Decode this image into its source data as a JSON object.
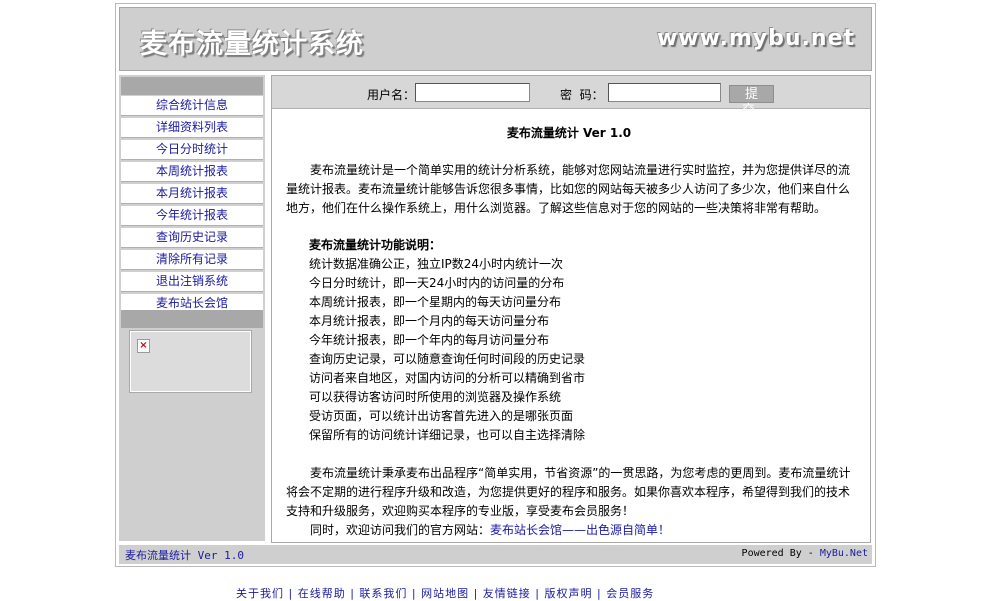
{
  "header": {
    "title": "麦布流量统计系统",
    "url": "www.mybu.net"
  },
  "sidebar": {
    "items": [
      "综合统计信息",
      "详细资料列表",
      "今日分时统计",
      "本周统计报表",
      "本月统计报表",
      "今年统计报表",
      "查询历史记录",
      "清除所有记录",
      "退出注销系统",
      "麦布站长会馆"
    ],
    "broken_image_glyph": "×"
  },
  "login": {
    "username_label": "用户名：",
    "password_label": "密  码：",
    "username_value": "",
    "password_value": "",
    "submit_label": "提交"
  },
  "content": {
    "title": "麦布流量统计 Ver 1.0",
    "intro": "麦布流量统计是一个简单实用的统计分析系统，能够对您网站流量进行实时监控，并为您提供详尽的流量统计报表。麦布流量统计能够告诉您很多事情，比如您的网站每天被多少人访问了多少次，他们来自什么地方，他们在什么操作系统上，用什么浏览器。了解这些信息对于您的网站的一些决策将非常有帮助。",
    "features_heading": "麦布流量统计功能说明：",
    "features": [
      "统计数据准确公正，独立IP数24小时内统计一次",
      "今日分时统计，即一天24小时内的访问量的分布",
      "本周统计报表，即一个星期内的每天访问量分布",
      "本月统计报表，即一个月内的每天访问量分布",
      "今年统计报表，即一个年内的每月访问量分布",
      "查询历史记录，可以随意查询任何时间段的历史记录",
      "访问者来自地区，对国内访问的分析可以精确到省市",
      "可以获得访客访问时所使用的浏览器及操作系统",
      "受访页面，可以统计出访客首先进入的是哪张页面",
      "保留所有的访问统计详细记录，也可以自主选择清除"
    ],
    "closing": "麦布流量统计秉承麦布出品程序“简单实用，节省资源”的一贯思路，为您考虑的更周到。麦布流量统计将会不定期的进行程序升级和改造，为您提供更好的程序和服务。如果你喜欢本程序，希望得到我们的技术支持和升级服务，欢迎购买本程序的专业版，享受麦布会员服务！",
    "visit_prefix": "同时，欢迎访问我们的官方网站：",
    "visit_link": "麦布站长会馆——出色源自简单！"
  },
  "footer": {
    "left": "麦布流量统计 Ver 1.0",
    "powered_prefix": "Powered By - ",
    "powered_link": "MyBu.Net"
  },
  "bottom_links": "关于我们 | 在线帮助 | 联系我们 | 网站地图 | 友情链接 | 版权声明 | 会员服务"
}
